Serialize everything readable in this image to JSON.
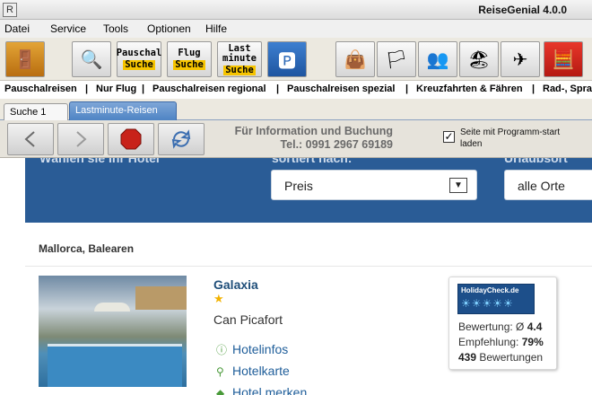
{
  "window": {
    "title": "ReiseGenial 4.0.0",
    "sys_icon": "R"
  },
  "menu": [
    "Datei",
    "Service",
    "Tools",
    "Optionen",
    "Hilfe"
  ],
  "toolbar": {
    "buttons": [
      {
        "name": "home-door-icon",
        "glyph": "🚪"
      },
      {
        "name": "suche-icon",
        "glyph": "🔍"
      },
      {
        "name": "pauschal-suche",
        "l1": "Pauschal",
        "l2": "Suche"
      },
      {
        "name": "flug-suche",
        "l1": "Flug",
        "l2": "Suche"
      },
      {
        "name": "lastminute-suche",
        "l1": "Last minute",
        "l2": "Suche"
      },
      {
        "name": "parking-icon",
        "glyph": "🅿"
      },
      {
        "name": "bag-icon",
        "glyph": "👜"
      },
      {
        "name": "flags-icon",
        "glyph": "🏳"
      },
      {
        "name": "people-icon",
        "glyph": "👥"
      },
      {
        "name": "beach-icon",
        "glyph": "🏖"
      },
      {
        "name": "airplane-icon",
        "glyph": "✈"
      },
      {
        "name": "calculator-icon",
        "glyph": "🧮"
      }
    ]
  },
  "categories": [
    "Pauschalreisen",
    "Nur Flug",
    "Pauschalreisen regional",
    "Pauschalreisen spezial",
    "Kreuzfahrten & Fähren",
    "Rad-, Spra"
  ],
  "tabs": [
    {
      "label": "Suche 1"
    },
    {
      "label": "Lastminute-Reisen"
    }
  ],
  "info": {
    "line1": "Für Information und Buchung",
    "line2": "Tel.: 0991 2967 69189"
  },
  "checkbox": {
    "checked": true,
    "label": "Seite mit Programm-start laden"
  },
  "web": {
    "band_cut_left": "Wählen sie Ihr Hotel",
    "band_cut_mid": "sortiert nach:",
    "band_cut_right": "Urlaubsort",
    "sort_value": "Preis",
    "place_value": "alle Orte",
    "region": "Mallorca, Balearen",
    "hotel": {
      "name": "Galaxia",
      "stars": 1,
      "location": "Can Picafort",
      "links": [
        "Hotelinfos",
        "Hotelkarte",
        "Hotel merken"
      ]
    },
    "holidaycheck": {
      "logo": "HolidayCheck.de",
      "rating_label": "Bewertung: Ø",
      "rating_value": "4.4",
      "recommend_label": "Empfehlung:",
      "recommend_value": "79%",
      "reviews_count": "439",
      "reviews_label": "Bewertungen"
    }
  }
}
